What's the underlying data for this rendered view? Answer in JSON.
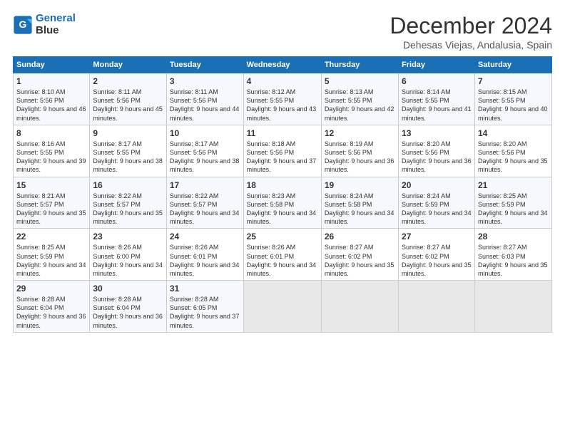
{
  "logo": {
    "line1": "General",
    "line2": "Blue"
  },
  "title": "December 2024",
  "location": "Dehesas Viejas, Andalusia, Spain",
  "headers": [
    "Sunday",
    "Monday",
    "Tuesday",
    "Wednesday",
    "Thursday",
    "Friday",
    "Saturday"
  ],
  "weeks": [
    [
      {
        "day": "1",
        "rise": "8:10 AM",
        "set": "5:56 PM",
        "daylight": "9 hours and 46 minutes."
      },
      {
        "day": "2",
        "rise": "8:11 AM",
        "set": "5:56 PM",
        "daylight": "9 hours and 45 minutes."
      },
      {
        "day": "3",
        "rise": "8:11 AM",
        "set": "5:56 PM",
        "daylight": "9 hours and 44 minutes."
      },
      {
        "day": "4",
        "rise": "8:12 AM",
        "set": "5:55 PM",
        "daylight": "9 hours and 43 minutes."
      },
      {
        "day": "5",
        "rise": "8:13 AM",
        "set": "5:55 PM",
        "daylight": "9 hours and 42 minutes."
      },
      {
        "day": "6",
        "rise": "8:14 AM",
        "set": "5:55 PM",
        "daylight": "9 hours and 41 minutes."
      },
      {
        "day": "7",
        "rise": "8:15 AM",
        "set": "5:55 PM",
        "daylight": "9 hours and 40 minutes."
      }
    ],
    [
      {
        "day": "8",
        "rise": "8:16 AM",
        "set": "5:55 PM",
        "daylight": "9 hours and 39 minutes."
      },
      {
        "day": "9",
        "rise": "8:17 AM",
        "set": "5:55 PM",
        "daylight": "9 hours and 38 minutes."
      },
      {
        "day": "10",
        "rise": "8:17 AM",
        "set": "5:56 PM",
        "daylight": "9 hours and 38 minutes."
      },
      {
        "day": "11",
        "rise": "8:18 AM",
        "set": "5:56 PM",
        "daylight": "9 hours and 37 minutes."
      },
      {
        "day": "12",
        "rise": "8:19 AM",
        "set": "5:56 PM",
        "daylight": "9 hours and 36 minutes."
      },
      {
        "day": "13",
        "rise": "8:20 AM",
        "set": "5:56 PM",
        "daylight": "9 hours and 36 minutes."
      },
      {
        "day": "14",
        "rise": "8:20 AM",
        "set": "5:56 PM",
        "daylight": "9 hours and 35 minutes."
      }
    ],
    [
      {
        "day": "15",
        "rise": "8:21 AM",
        "set": "5:57 PM",
        "daylight": "9 hours and 35 minutes."
      },
      {
        "day": "16",
        "rise": "8:22 AM",
        "set": "5:57 PM",
        "daylight": "9 hours and 35 minutes."
      },
      {
        "day": "17",
        "rise": "8:22 AM",
        "set": "5:57 PM",
        "daylight": "9 hours and 34 minutes."
      },
      {
        "day": "18",
        "rise": "8:23 AM",
        "set": "5:58 PM",
        "daylight": "9 hours and 34 minutes."
      },
      {
        "day": "19",
        "rise": "8:24 AM",
        "set": "5:58 PM",
        "daylight": "9 hours and 34 minutes."
      },
      {
        "day": "20",
        "rise": "8:24 AM",
        "set": "5:59 PM",
        "daylight": "9 hours and 34 minutes."
      },
      {
        "day": "21",
        "rise": "8:25 AM",
        "set": "5:59 PM",
        "daylight": "9 hours and 34 minutes."
      }
    ],
    [
      {
        "day": "22",
        "rise": "8:25 AM",
        "set": "5:59 PM",
        "daylight": "9 hours and 34 minutes."
      },
      {
        "day": "23",
        "rise": "8:26 AM",
        "set": "6:00 PM",
        "daylight": "9 hours and 34 minutes."
      },
      {
        "day": "24",
        "rise": "8:26 AM",
        "set": "6:01 PM",
        "daylight": "9 hours and 34 minutes."
      },
      {
        "day": "25",
        "rise": "8:26 AM",
        "set": "6:01 PM",
        "daylight": "9 hours and 34 minutes."
      },
      {
        "day": "26",
        "rise": "8:27 AM",
        "set": "6:02 PM",
        "daylight": "9 hours and 35 minutes."
      },
      {
        "day": "27",
        "rise": "8:27 AM",
        "set": "6:02 PM",
        "daylight": "9 hours and 35 minutes."
      },
      {
        "day": "28",
        "rise": "8:27 AM",
        "set": "6:03 PM",
        "daylight": "9 hours and 35 minutes."
      }
    ],
    [
      {
        "day": "29",
        "rise": "8:28 AM",
        "set": "6:04 PM",
        "daylight": "9 hours and 36 minutes."
      },
      {
        "day": "30",
        "rise": "8:28 AM",
        "set": "6:04 PM",
        "daylight": "9 hours and 36 minutes."
      },
      {
        "day": "31",
        "rise": "8:28 AM",
        "set": "6:05 PM",
        "daylight": "9 hours and 37 minutes."
      },
      null,
      null,
      null,
      null
    ]
  ]
}
